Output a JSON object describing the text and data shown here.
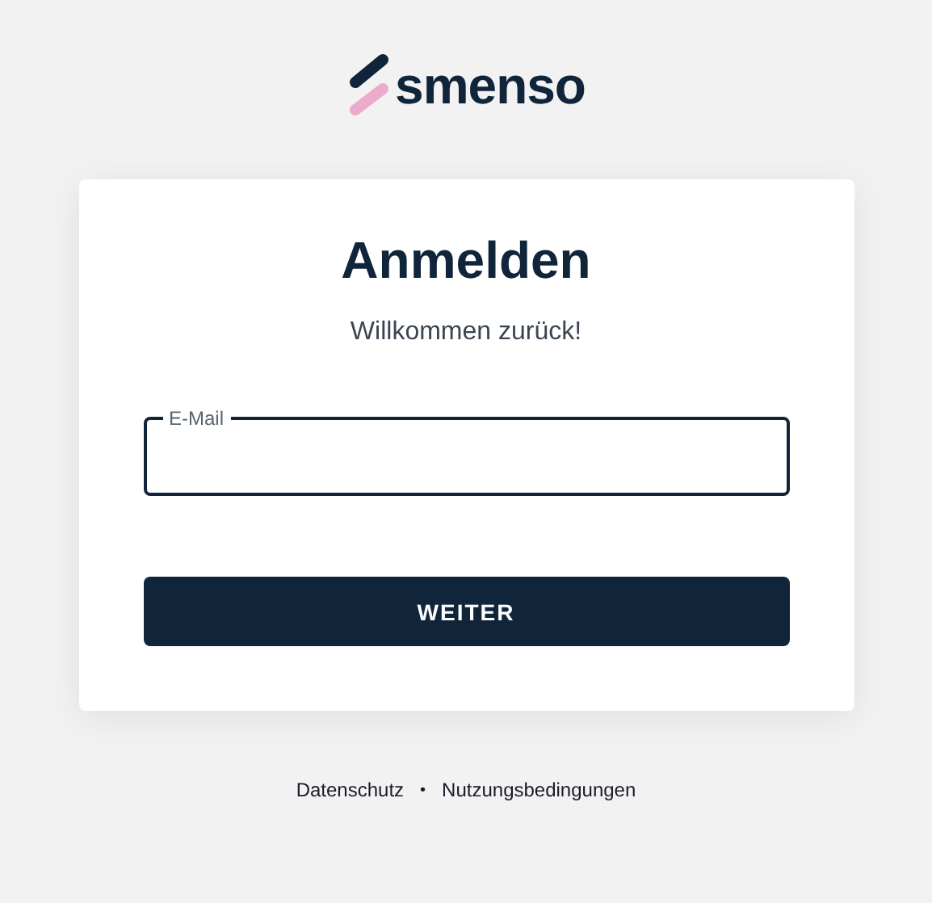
{
  "logo": {
    "name": "smenso"
  },
  "card": {
    "title": "Anmelden",
    "subtitle": "Willkommen zurück!",
    "field": {
      "label": "E-Mail"
    },
    "button": {
      "label": "WEITER"
    }
  },
  "footer": {
    "links": [
      "Datenschutz",
      "Nutzungsbedingungen"
    ],
    "separator": "•"
  }
}
